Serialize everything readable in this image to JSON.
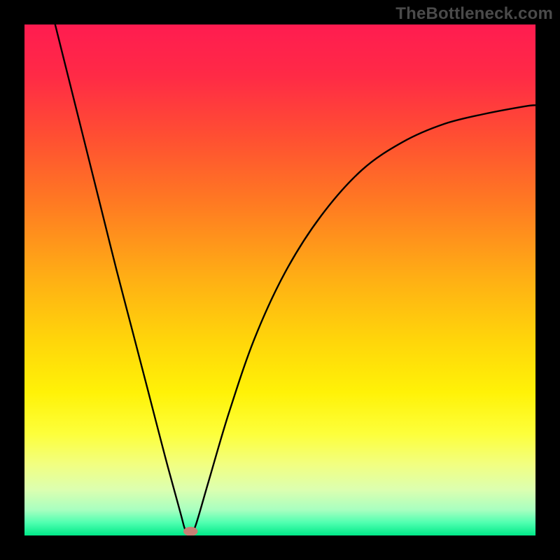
{
  "watermark": "TheBottleneck.com",
  "chart_data": {
    "type": "line",
    "title": "",
    "xlabel": "",
    "ylabel": "",
    "xlim": [
      0,
      100
    ],
    "ylim": [
      0,
      100
    ],
    "grid": false,
    "legend": false,
    "background_gradient": {
      "stops": [
        {
          "pos": 0.0,
          "color": "#ff1c50"
        },
        {
          "pos": 0.1,
          "color": "#ff2a46"
        },
        {
          "pos": 0.22,
          "color": "#ff4f32"
        },
        {
          "pos": 0.35,
          "color": "#ff7a22"
        },
        {
          "pos": 0.5,
          "color": "#ffb014"
        },
        {
          "pos": 0.62,
          "color": "#ffd60a"
        },
        {
          "pos": 0.72,
          "color": "#fff207"
        },
        {
          "pos": 0.8,
          "color": "#fdff3a"
        },
        {
          "pos": 0.86,
          "color": "#f2ff80"
        },
        {
          "pos": 0.91,
          "color": "#dcffb0"
        },
        {
          "pos": 0.95,
          "color": "#a8ffc0"
        },
        {
          "pos": 0.975,
          "color": "#4fffb0"
        },
        {
          "pos": 1.0,
          "color": "#00e988"
        }
      ]
    },
    "series": [
      {
        "name": "curve",
        "x": [
          6.0,
          8.0,
          10.0,
          12.5,
          15.0,
          18.0,
          21.0,
          24.0,
          27.5,
          30.5,
          31.5,
          32.5,
          33.5,
          36.0,
          40.0,
          45.0,
          51.0,
          58.0,
          66.0,
          74.0,
          82.0,
          90.0,
          98.0,
          100.0
        ],
        "y": [
          100.0,
          92.0,
          84.0,
          74.0,
          64.0,
          52.0,
          40.5,
          29.0,
          15.5,
          4.5,
          1.0,
          0.4,
          2.0,
          10.5,
          24.0,
          38.5,
          51.5,
          62.5,
          71.5,
          77.0,
          80.5,
          82.5,
          84.0,
          84.2
        ]
      }
    ],
    "marker": {
      "x": 32.5,
      "y": 0.8,
      "color": "#c78075",
      "rx": 1.4,
      "ry": 0.9
    }
  }
}
